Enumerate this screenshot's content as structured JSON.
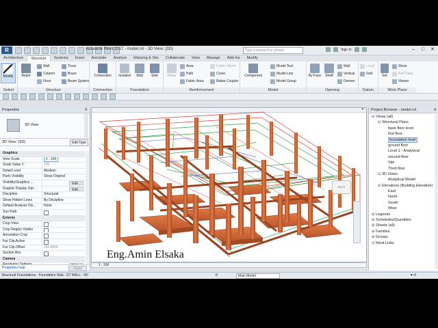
{
  "window": {
    "title": "Autodesk Revit 2017 -    model.rvt - 3D View: {3D}",
    "search_placeholder": "Type a keyword or phrase",
    "sign_in": "Sign In",
    "logo": "R"
  },
  "tabs": [
    "Architecture",
    "Structure",
    "Systems",
    "Insert",
    "Annotate",
    "Analyze",
    "Massing & Site",
    "Collaborate",
    "View",
    "Manage",
    "Add-Ins",
    "Modify"
  ],
  "active_tab": "Structure",
  "ribbon": {
    "select": {
      "modify": "Modify",
      "label": "Select"
    },
    "structure": {
      "beam": "Beam",
      "wall": "Wall",
      "column": "Column",
      "floor": "Floor",
      "truss": "Truss",
      "brace": "Brace",
      "beam_system": "Beam System",
      "label": "Structure"
    },
    "connection": {
      "connection": "Connection",
      "label": "Connection"
    },
    "foundation": {
      "isolated": "Isolated",
      "wall": "Wall",
      "slab": "Slab",
      "label": "Foundation"
    },
    "reinforcement": {
      "rebar": "Rebar",
      "area": "Area",
      "path": "Path",
      "fabric_area": "Fabric Area",
      "fabric_sheet": "Fabric Sheet",
      "cover": "Cover",
      "rebar_coupler": "Rebar Coupler",
      "label": "Reinforcement"
    },
    "model": {
      "component": "Component",
      "model_text": "Model Text",
      "model_line": "Model Line",
      "model_group": "Model Group",
      "label": "Model"
    },
    "opening": {
      "by_face": "By Face",
      "shaft": "Shaft",
      "wall": "Wall",
      "vertical": "Vertical",
      "dormer": "Dormer",
      "label": "Opening"
    },
    "datum": {
      "level": "Level",
      "grid": "Grid",
      "label": "Datum"
    },
    "work_plane": {
      "set": "Set",
      "show": "Show",
      "ref_plane": "Ref Plane",
      "viewer": "Viewer",
      "label": "Work Plane"
    }
  },
  "properties": {
    "title": "Properties",
    "type_name": "3D View",
    "filter": "3D View: {3D}",
    "edit_type": "Edit Type",
    "rows": [
      {
        "k": "Graphics",
        "sec": true
      },
      {
        "k": "View Scale",
        "v": "1 : 100",
        "box": true
      },
      {
        "k": "Scale Value    1:",
        "v": "100",
        "dim": true
      },
      {
        "k": "Detail Level",
        "v": "Medium"
      },
      {
        "k": "Parts Visibility",
        "v": "Show Original"
      },
      {
        "k": "Visibility/Graphics ...",
        "btn": "Edit..."
      },
      {
        "k": "Graphic Display Opt...",
        "btn": "Edit..."
      },
      {
        "k": "Discipline",
        "v": "Structural"
      },
      {
        "k": "Show Hidden Lines",
        "v": "By Discipline"
      },
      {
        "k": "Default Analysis Dis...",
        "v": "None"
      },
      {
        "k": "Sun Path",
        "cb": true
      },
      {
        "k": "Extents",
        "sec": true
      },
      {
        "k": "Crop View",
        "cb": true
      },
      {
        "k": "Crop Region Visible",
        "cb": true
      },
      {
        "k": "Annotation Crop",
        "cb": true
      },
      {
        "k": "Far Clip Active",
        "cb": true
      },
      {
        "k": "Far Clip Offset",
        "v": "304.8000",
        "dim": true
      },
      {
        "k": "Section Box",
        "cb": true
      },
      {
        "k": "Camera",
        "sec": true
      },
      {
        "k": "Rendering Settings",
        "btn": "Edit..."
      },
      {
        "k": "Locked Orientation",
        "v": ""
      }
    ],
    "help": "Properties help",
    "apply": "Apply"
  },
  "view": {
    "watermark": "Eng.Amin Elsaka",
    "scale": "1 : 100",
    "cube_label": "BACK"
  },
  "project_browser": {
    "title": "Project Browser - model.rvt",
    "items": [
      {
        "t": "Views (all)",
        "lvl": 0,
        "tg": "⊟"
      },
      {
        "t": "Structural Plans",
        "lvl": 1,
        "tg": "⊟"
      },
      {
        "t": "base floor level",
        "lvl": 2
      },
      {
        "t": "first floor",
        "lvl": 2
      },
      {
        "t": "foundation level",
        "lvl": 2,
        "sel": true
      },
      {
        "t": "ground floor",
        "lvl": 2
      },
      {
        "t": "Level 1 - Analytical",
        "lvl": 2
      },
      {
        "t": "second floor",
        "lvl": 2
      },
      {
        "t": "Site",
        "lvl": 2
      },
      {
        "t": "Third floor",
        "lvl": 2
      },
      {
        "t": "3D Views",
        "lvl": 1,
        "tg": "⊟"
      },
      {
        "t": "Analytical Model",
        "lvl": 2
      },
      {
        "t": "Elevations (Building Elevation)",
        "lvl": 1,
        "tg": "⊟"
      },
      {
        "t": "East",
        "lvl": 2
      },
      {
        "t": "North",
        "lvl": 2
      },
      {
        "t": "South",
        "lvl": 2
      },
      {
        "t": "West",
        "lvl": 2
      },
      {
        "t": "Legends",
        "lvl": 0,
        "tg": "⊞"
      },
      {
        "t": "Schedules/Quantities",
        "lvl": 0,
        "tg": "⊞"
      },
      {
        "t": "Sheets (all)",
        "lvl": 0,
        "tg": "⊞"
      },
      {
        "t": "Families",
        "lvl": 0,
        "tg": "⊞"
      },
      {
        "t": "Groups",
        "lvl": 0,
        "tg": "⊞"
      },
      {
        "t": "Revit Links",
        "lvl": 0,
        "tg": "⊡"
      }
    ]
  },
  "statusbar": {
    "text": "Structural Foundations : Foundation Slab : ST WALL - R0",
    "zero": ":0",
    "main_model": "Main Model"
  },
  "colors": {
    "accent": "#2b5a8a",
    "steel": "#c8693a",
    "grid_red": "#d63a3a",
    "grid_green": "#2fa14a"
  }
}
